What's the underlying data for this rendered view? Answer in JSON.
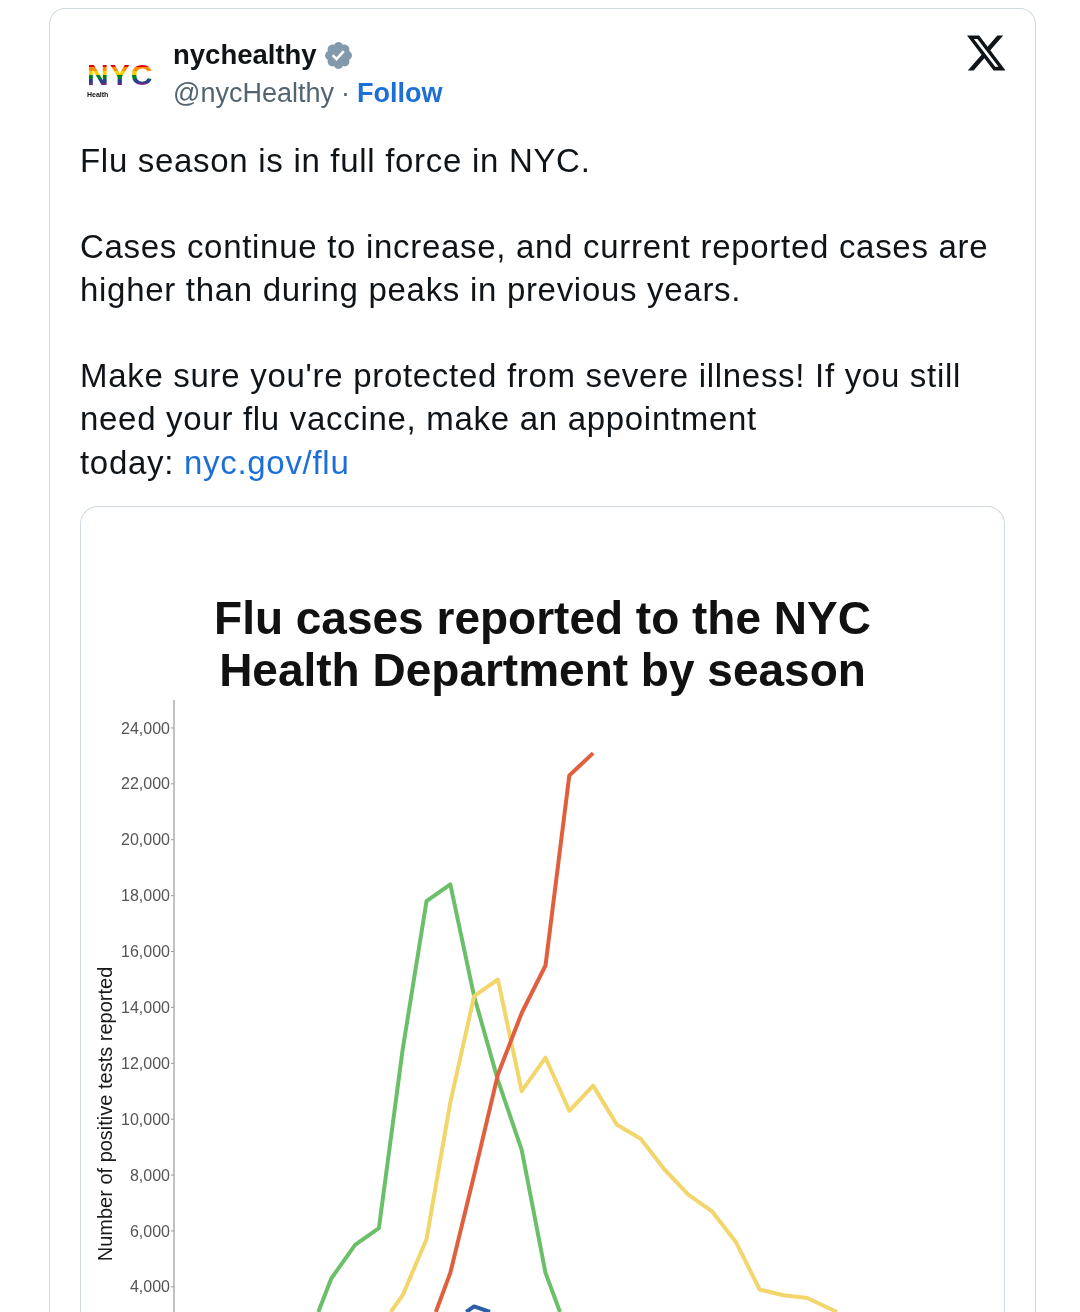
{
  "tweet": {
    "author": {
      "avatar": {
        "wordmark": "NYC",
        "caption": "Health"
      },
      "name": "nychealthy",
      "verified": true,
      "handle": "@nycHealthy",
      "separator": "·",
      "follow": "Follow"
    },
    "paragraphs": [
      {
        "text": "Flu season is in full force in NYC."
      },
      {
        "text": "Cases continue to increase, and current reported cases are higher than during peaks in previous years."
      },
      {
        "text": "Make sure you're protected from severe illness! If you still need your flu vaccine, make an appointment today:",
        "link": "nyc.gov/flu"
      }
    ],
    "media": {
      "chart": {
        "title": "Flu cases reported to the NYC Health Department by season",
        "y_axis_title": "Number of positive tests reported",
        "y_tick_labels": [
          "24,000",
          "22,000",
          "20,000",
          "18,000",
          "16,000",
          "14,000",
          "12,000",
          "10,000",
          "8,000",
          "6,000",
          "4,000"
        ]
      }
    }
  }
}
